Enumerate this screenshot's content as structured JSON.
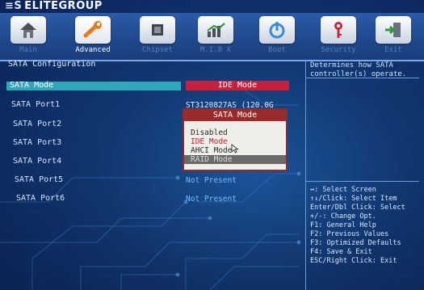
{
  "brand": {
    "mark": "≡S",
    "name": "ELITEGROUP"
  },
  "tabs": [
    {
      "label": "Main",
      "icon": "home-icon"
    },
    {
      "label": "Advanced",
      "icon": "wrench-icon"
    },
    {
      "label": "Chipset",
      "icon": "chip-icon"
    },
    {
      "label": "M.I.B X",
      "icon": "chart-icon"
    },
    {
      "label": "Boot",
      "icon": "power-icon"
    },
    {
      "label": "Security",
      "icon": "key-icon"
    },
    {
      "label": "Exit",
      "icon": "exit-door-icon"
    }
  ],
  "section_title": "SATA Configuration",
  "settings": [
    {
      "name": "SATA Mode",
      "value": "IDE Mode"
    },
    {
      "name": "SATA Port1",
      "value": "ST3120827AS   (120.0G"
    },
    {
      "name": "SATA Port2",
      "value": ""
    },
    {
      "name": "SATA Port3",
      "value": ""
    },
    {
      "name": "SATA Port4",
      "value": ""
    },
    {
      "name": "SATA Port5",
      "value": "Not Present"
    },
    {
      "name": "SATA Port6",
      "value": "Not Present"
    }
  ],
  "popup": {
    "title": "SATA Mode",
    "options": [
      "Disabled",
      "IDE Mode",
      "AHCI Mode",
      "RAID Mode"
    ],
    "current": "IDE Mode",
    "highlighted": "RAID Mode"
  },
  "help": {
    "description": "Determines how SATA controller(s) operate.",
    "keys": [
      "↔: Select Screen",
      "↑↓/Click: Select Item",
      "Enter/Dbl Click: Select",
      "+/-: Change Opt.",
      "F1: General Help",
      "F2: Previous Values",
      "F3: Optimized Defaults",
      "F4: Save & Exit",
      "ESC/Right Click: Exit"
    ]
  },
  "colors": {
    "selection_bar": "#2fa7b8",
    "value_highlight": "#c8203c",
    "popup_title": "#9a2b2b"
  }
}
